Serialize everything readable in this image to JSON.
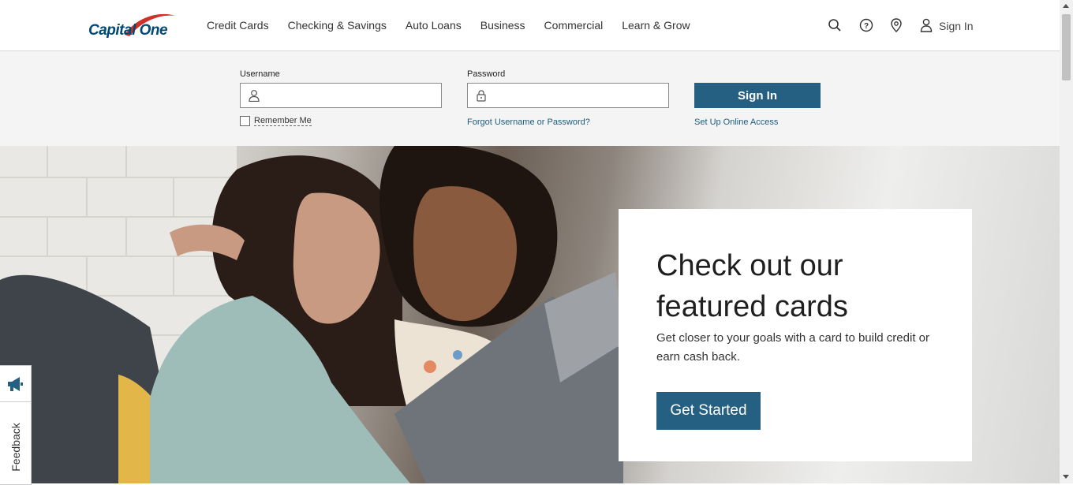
{
  "brand": {
    "logo_text": "Capital One",
    "color": "#004977",
    "swoosh_color": "#d03027"
  },
  "nav": {
    "items": [
      "Credit Cards",
      "Checking & Savings",
      "Auto Loans",
      "Business",
      "Commercial",
      "Learn & Grow"
    ]
  },
  "utility": {
    "search_icon": "search-icon",
    "help_icon": "help-icon",
    "location_icon": "location-pin-icon",
    "user_icon": "user-icon",
    "sign_in": "Sign In"
  },
  "login": {
    "username_label": "Username",
    "password_label": "Password",
    "username_value": "",
    "password_value": "",
    "sign_in_button": "Sign In",
    "remember_me": "Remember Me",
    "forgot_link": "Forgot Username or Password?",
    "setup_link": "Set Up Online Access"
  },
  "hero": {
    "heading": "Check out our featured cards",
    "body": "Get closer to your goals with a card to build credit or earn cash back.",
    "cta": "Get Started"
  },
  "feedback": {
    "label": "Feedback",
    "icon": "megaphone-icon"
  },
  "colors": {
    "button": "#255f82",
    "link": "#1e5a7a",
    "strip_bg": "#f4f4f4"
  }
}
